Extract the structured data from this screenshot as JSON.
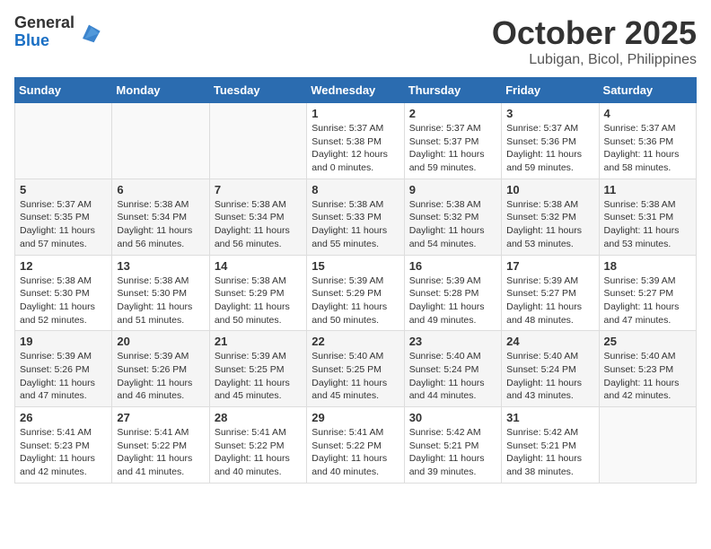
{
  "header": {
    "logo_general": "General",
    "logo_blue": "Blue",
    "month_title": "October 2025",
    "location": "Lubigan, Bicol, Philippines"
  },
  "weekdays": [
    "Sunday",
    "Monday",
    "Tuesday",
    "Wednesday",
    "Thursday",
    "Friday",
    "Saturday"
  ],
  "weeks": [
    [
      {
        "day": "",
        "info": ""
      },
      {
        "day": "",
        "info": ""
      },
      {
        "day": "",
        "info": ""
      },
      {
        "day": "1",
        "info": "Sunrise: 5:37 AM\nSunset: 5:38 PM\nDaylight: 12 hours\nand 0 minutes."
      },
      {
        "day": "2",
        "info": "Sunrise: 5:37 AM\nSunset: 5:37 PM\nDaylight: 11 hours\nand 59 minutes."
      },
      {
        "day": "3",
        "info": "Sunrise: 5:37 AM\nSunset: 5:36 PM\nDaylight: 11 hours\nand 59 minutes."
      },
      {
        "day": "4",
        "info": "Sunrise: 5:37 AM\nSunset: 5:36 PM\nDaylight: 11 hours\nand 58 minutes."
      }
    ],
    [
      {
        "day": "5",
        "info": "Sunrise: 5:37 AM\nSunset: 5:35 PM\nDaylight: 11 hours\nand 57 minutes."
      },
      {
        "day": "6",
        "info": "Sunrise: 5:38 AM\nSunset: 5:34 PM\nDaylight: 11 hours\nand 56 minutes."
      },
      {
        "day": "7",
        "info": "Sunrise: 5:38 AM\nSunset: 5:34 PM\nDaylight: 11 hours\nand 56 minutes."
      },
      {
        "day": "8",
        "info": "Sunrise: 5:38 AM\nSunset: 5:33 PM\nDaylight: 11 hours\nand 55 minutes."
      },
      {
        "day": "9",
        "info": "Sunrise: 5:38 AM\nSunset: 5:32 PM\nDaylight: 11 hours\nand 54 minutes."
      },
      {
        "day": "10",
        "info": "Sunrise: 5:38 AM\nSunset: 5:32 PM\nDaylight: 11 hours\nand 53 minutes."
      },
      {
        "day": "11",
        "info": "Sunrise: 5:38 AM\nSunset: 5:31 PM\nDaylight: 11 hours\nand 53 minutes."
      }
    ],
    [
      {
        "day": "12",
        "info": "Sunrise: 5:38 AM\nSunset: 5:30 PM\nDaylight: 11 hours\nand 52 minutes."
      },
      {
        "day": "13",
        "info": "Sunrise: 5:38 AM\nSunset: 5:30 PM\nDaylight: 11 hours\nand 51 minutes."
      },
      {
        "day": "14",
        "info": "Sunrise: 5:38 AM\nSunset: 5:29 PM\nDaylight: 11 hours\nand 50 minutes."
      },
      {
        "day": "15",
        "info": "Sunrise: 5:39 AM\nSunset: 5:29 PM\nDaylight: 11 hours\nand 50 minutes."
      },
      {
        "day": "16",
        "info": "Sunrise: 5:39 AM\nSunset: 5:28 PM\nDaylight: 11 hours\nand 49 minutes."
      },
      {
        "day": "17",
        "info": "Sunrise: 5:39 AM\nSunset: 5:27 PM\nDaylight: 11 hours\nand 48 minutes."
      },
      {
        "day": "18",
        "info": "Sunrise: 5:39 AM\nSunset: 5:27 PM\nDaylight: 11 hours\nand 47 minutes."
      }
    ],
    [
      {
        "day": "19",
        "info": "Sunrise: 5:39 AM\nSunset: 5:26 PM\nDaylight: 11 hours\nand 47 minutes."
      },
      {
        "day": "20",
        "info": "Sunrise: 5:39 AM\nSunset: 5:26 PM\nDaylight: 11 hours\nand 46 minutes."
      },
      {
        "day": "21",
        "info": "Sunrise: 5:39 AM\nSunset: 5:25 PM\nDaylight: 11 hours\nand 45 minutes."
      },
      {
        "day": "22",
        "info": "Sunrise: 5:40 AM\nSunset: 5:25 PM\nDaylight: 11 hours\nand 45 minutes."
      },
      {
        "day": "23",
        "info": "Sunrise: 5:40 AM\nSunset: 5:24 PM\nDaylight: 11 hours\nand 44 minutes."
      },
      {
        "day": "24",
        "info": "Sunrise: 5:40 AM\nSunset: 5:24 PM\nDaylight: 11 hours\nand 43 minutes."
      },
      {
        "day": "25",
        "info": "Sunrise: 5:40 AM\nSunset: 5:23 PM\nDaylight: 11 hours\nand 42 minutes."
      }
    ],
    [
      {
        "day": "26",
        "info": "Sunrise: 5:41 AM\nSunset: 5:23 PM\nDaylight: 11 hours\nand 42 minutes."
      },
      {
        "day": "27",
        "info": "Sunrise: 5:41 AM\nSunset: 5:22 PM\nDaylight: 11 hours\nand 41 minutes."
      },
      {
        "day": "28",
        "info": "Sunrise: 5:41 AM\nSunset: 5:22 PM\nDaylight: 11 hours\nand 40 minutes."
      },
      {
        "day": "29",
        "info": "Sunrise: 5:41 AM\nSunset: 5:22 PM\nDaylight: 11 hours\nand 40 minutes."
      },
      {
        "day": "30",
        "info": "Sunrise: 5:42 AM\nSunset: 5:21 PM\nDaylight: 11 hours\nand 39 minutes."
      },
      {
        "day": "31",
        "info": "Sunrise: 5:42 AM\nSunset: 5:21 PM\nDaylight: 11 hours\nand 38 minutes."
      },
      {
        "day": "",
        "info": ""
      }
    ]
  ]
}
